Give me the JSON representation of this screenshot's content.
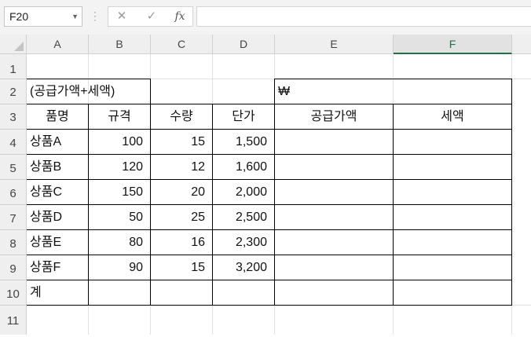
{
  "formula_bar": {
    "name_box": "F20",
    "cancel_icon": "✕",
    "enter_icon": "✓",
    "fx_label": "fx",
    "formula": ""
  },
  "columns": [
    "A",
    "B",
    "C",
    "D",
    "E",
    "F"
  ],
  "rows": [
    "1",
    "2",
    "3",
    "4",
    "5",
    "6",
    "7",
    "8",
    "9",
    "10",
    "11"
  ],
  "sheet": {
    "title_cell": "(공급가액+세액)",
    "currency_cell": "₩",
    "headers": [
      "품명",
      "규격",
      "수량",
      "단가",
      "공급가액",
      "세액"
    ],
    "items": [
      {
        "name": "상품A",
        "spec": "100",
        "qty": "15",
        "price": "1,500",
        "supply": "",
        "tax": ""
      },
      {
        "name": "상품B",
        "spec": "120",
        "qty": "12",
        "price": "1,600",
        "supply": "",
        "tax": ""
      },
      {
        "name": "상품C",
        "spec": "150",
        "qty": "20",
        "price": "2,000",
        "supply": "",
        "tax": ""
      },
      {
        "name": "상품D",
        "spec": "50",
        "qty": "25",
        "price": "2,500",
        "supply": "",
        "tax": ""
      },
      {
        "name": "상품E",
        "spec": "80",
        "qty": "16",
        "price": "2,300",
        "supply": "",
        "tax": ""
      },
      {
        "name": "상품F",
        "spec": "90",
        "qty": "15",
        "price": "3,200",
        "supply": "",
        "tax": ""
      }
    ],
    "total_label": "계"
  },
  "colors": {
    "selected_column": "#217346",
    "header_bg": "#efefef",
    "gridline": "#e1e1e1",
    "border": "#000000"
  }
}
